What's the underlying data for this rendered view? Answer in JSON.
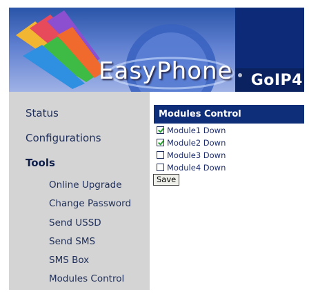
{
  "banner": {
    "logo_text": "EasyPhone",
    "product_name": "GoIP4"
  },
  "sidebar": {
    "main_items": [
      {
        "label": "Status",
        "active": false
      },
      {
        "label": "Configurations",
        "active": false
      },
      {
        "label": "Tools",
        "active": true
      }
    ],
    "sub_items": [
      {
        "label": "Online Upgrade"
      },
      {
        "label": "Change Password"
      },
      {
        "label": "Send USSD"
      },
      {
        "label": "Send SMS"
      },
      {
        "label": "SMS Box"
      },
      {
        "label": "Modules Control"
      }
    ]
  },
  "main": {
    "title": "Modules Control",
    "modules": [
      {
        "label": "Module1 Down",
        "checked": true
      },
      {
        "label": "Module2 Down",
        "checked": true
      },
      {
        "label": "Module3 Down",
        "checked": false
      },
      {
        "label": "Module4 Down",
        "checked": false
      }
    ],
    "save_label": "Save"
  },
  "colors": {
    "banner_blue": "#2a55a8",
    "header_navy": "#0f2e7a",
    "sidebar_gray": "#d4d4d4",
    "nav_text": "#1f2f5a",
    "check_green": "#27a12f"
  }
}
